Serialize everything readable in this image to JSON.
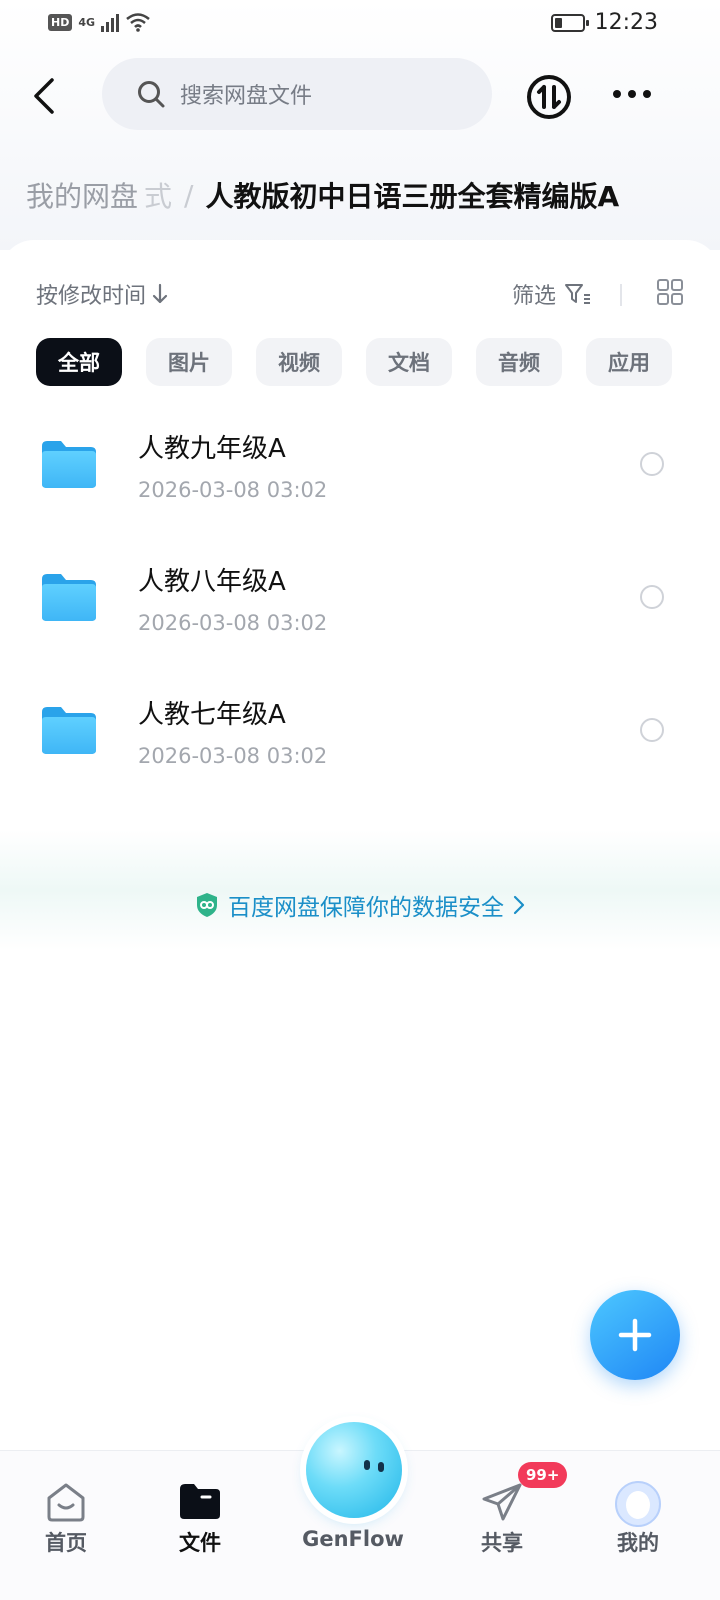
{
  "status_bar": {
    "hd": "HD",
    "network": "4G",
    "time": "12:23"
  },
  "header": {
    "search_placeholder": "搜索网盘文件"
  },
  "breadcrumb": {
    "root": "我的网盘",
    "faded": "式",
    "separator": "/",
    "current": "人教版初中日语三册全套精编版A"
  },
  "toolbar": {
    "sort_label": "按修改时间",
    "filter_label": "筛选"
  },
  "chips": [
    {
      "label": "全部",
      "active": true
    },
    {
      "label": "图片"
    },
    {
      "label": "视频"
    },
    {
      "label": "文档"
    },
    {
      "label": "音频"
    },
    {
      "label": "应用"
    }
  ],
  "files": [
    {
      "name": "人教九年级A",
      "date": "2026-03-08  03:02",
      "icon": "folder-icon"
    },
    {
      "name": "人教八年级A",
      "date": "2026-03-08  03:02",
      "icon": "folder-icon"
    },
    {
      "name": "人教七年级A",
      "date": "2026-03-08  03:02",
      "icon": "folder-icon"
    }
  ],
  "security_notice": "百度网盘保障你的数据安全",
  "bottom_nav": {
    "home": "首页",
    "files": "文件",
    "genflow": "GenFlow",
    "share": "共享",
    "mine": "我的",
    "share_badge": "99+"
  },
  "colors": {
    "accent_blue": "#1f86f5",
    "active_chip": "#0b0f17",
    "security_text": "#1b8fc8",
    "badge": "#f23a5a"
  }
}
